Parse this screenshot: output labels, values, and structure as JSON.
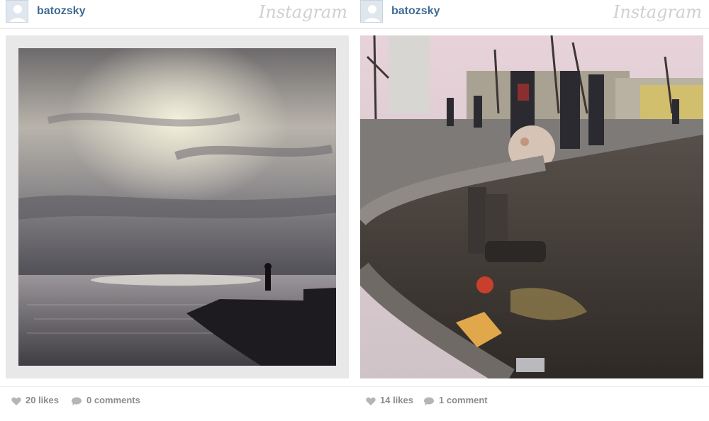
{
  "brand": "Instagram",
  "posts": [
    {
      "username": "batozsky",
      "likes": "20 likes",
      "comments": "0 comments",
      "photo": "sea-silhouette-photo"
    },
    {
      "username": "batozsky",
      "likes": "14 likes",
      "comments": "1 comment",
      "photo": "street-boots-photo"
    }
  ],
  "icons": {
    "avatar": "default-avatar-icon",
    "like": "heart-icon",
    "comment": "speech-bubble-icon"
  },
  "colors": {
    "username": "#3f6b93",
    "meta": "#8c8c8c",
    "brand": "#d0d0d0"
  }
}
